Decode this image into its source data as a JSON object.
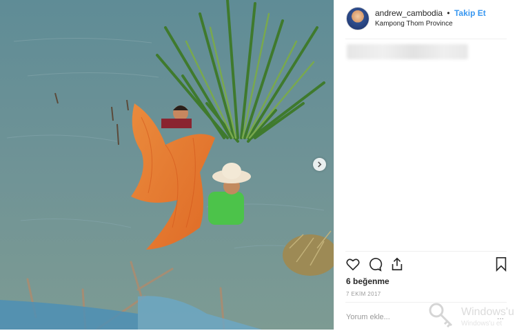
{
  "post": {
    "username": "andrew_cambodia",
    "separator": "•",
    "follow_label": "Takip Et",
    "location": "Kampong Thom Province",
    "likes": "6 beğenme",
    "date": "7 EKİM 2017",
    "comment_placeholder": "Yorum ekle...",
    "more_label": "..."
  },
  "watermark": {
    "title": "Windows'u",
    "subtitle": "Windows'u et"
  },
  "icons": {
    "like": "heart-icon",
    "comment": "comment-icon",
    "share": "share-icon",
    "save": "bookmark-icon",
    "next": "chevron-right-icon"
  },
  "colors": {
    "link": "#3897f0",
    "text": "#262626",
    "muted": "#999999",
    "net": "#f07a2a",
    "water": "#6d9398"
  }
}
